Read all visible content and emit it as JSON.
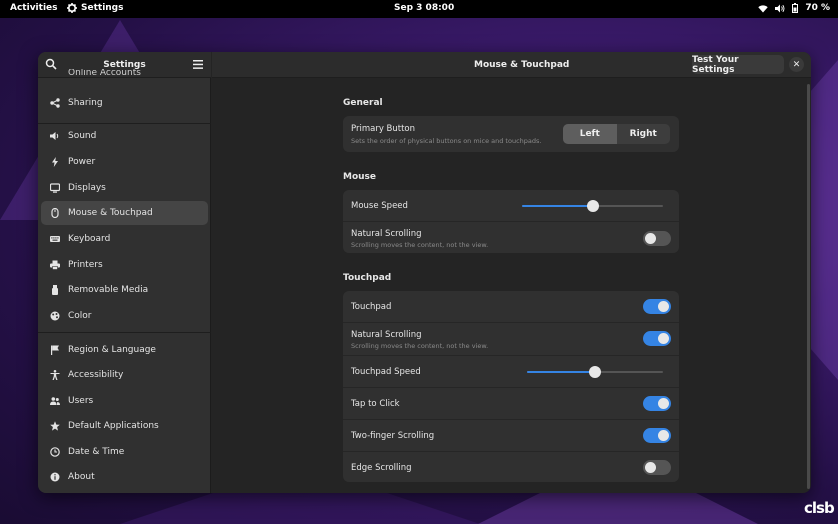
{
  "topbar": {
    "activities": "Activities",
    "app_name": "Settings",
    "clock": "Sep 3  08:00",
    "battery": "70 %"
  },
  "sidebar": {
    "title": "Settings",
    "partial_item": "Online Accounts",
    "items": [
      {
        "label": "Sharing",
        "icon": "share-icon"
      },
      {
        "label": "Sound",
        "icon": "speaker-icon"
      },
      {
        "label": "Power",
        "icon": "power-icon"
      },
      {
        "label": "Displays",
        "icon": "display-icon"
      },
      {
        "label": "Mouse & Touchpad",
        "icon": "mouse-icon",
        "active": true
      },
      {
        "label": "Keyboard",
        "icon": "keyboard-icon"
      },
      {
        "label": "Printers",
        "icon": "printer-icon"
      },
      {
        "label": "Removable Media",
        "icon": "usb-icon"
      },
      {
        "label": "Color",
        "icon": "palette-icon"
      },
      {
        "label": "Region & Language",
        "icon": "flag-icon"
      },
      {
        "label": "Accessibility",
        "icon": "accessibility-icon"
      },
      {
        "label": "Users",
        "icon": "users-icon"
      },
      {
        "label": "Default Applications",
        "icon": "star-icon"
      },
      {
        "label": "Date & Time",
        "icon": "clock-icon"
      },
      {
        "label": "About",
        "icon": "info-icon"
      }
    ]
  },
  "main": {
    "title": "Mouse & Touchpad",
    "test_button": "Test Your Settings",
    "close": "✕",
    "general": {
      "title": "General",
      "primary_button_label": "Primary Button",
      "primary_button_desc": "Sets the order of physical buttons on mice and touchpads.",
      "left": "Left",
      "right": "Right",
      "selected": "Left"
    },
    "mouse": {
      "title": "Mouse",
      "speed_label": "Mouse Speed",
      "speed_value": 0.5,
      "natural_label": "Natural Scrolling",
      "natural_desc": "Scrolling moves the content, not the view.",
      "natural_on": false
    },
    "touchpad": {
      "title": "Touchpad",
      "touchpad_label": "Touchpad",
      "touchpad_on": true,
      "natural_label": "Natural Scrolling",
      "natural_desc": "Scrolling moves the content, not the view.",
      "natural_on": true,
      "speed_label": "Touchpad Speed",
      "speed_value": 0.5,
      "tap_label": "Tap to Click",
      "tap_on": true,
      "twofinger_label": "Two-finger Scrolling",
      "twofinger_on": true,
      "edge_label": "Edge Scrolling",
      "edge_on": false
    }
  },
  "watermark": "clsb",
  "colors": {
    "accent": "#3584e4"
  }
}
